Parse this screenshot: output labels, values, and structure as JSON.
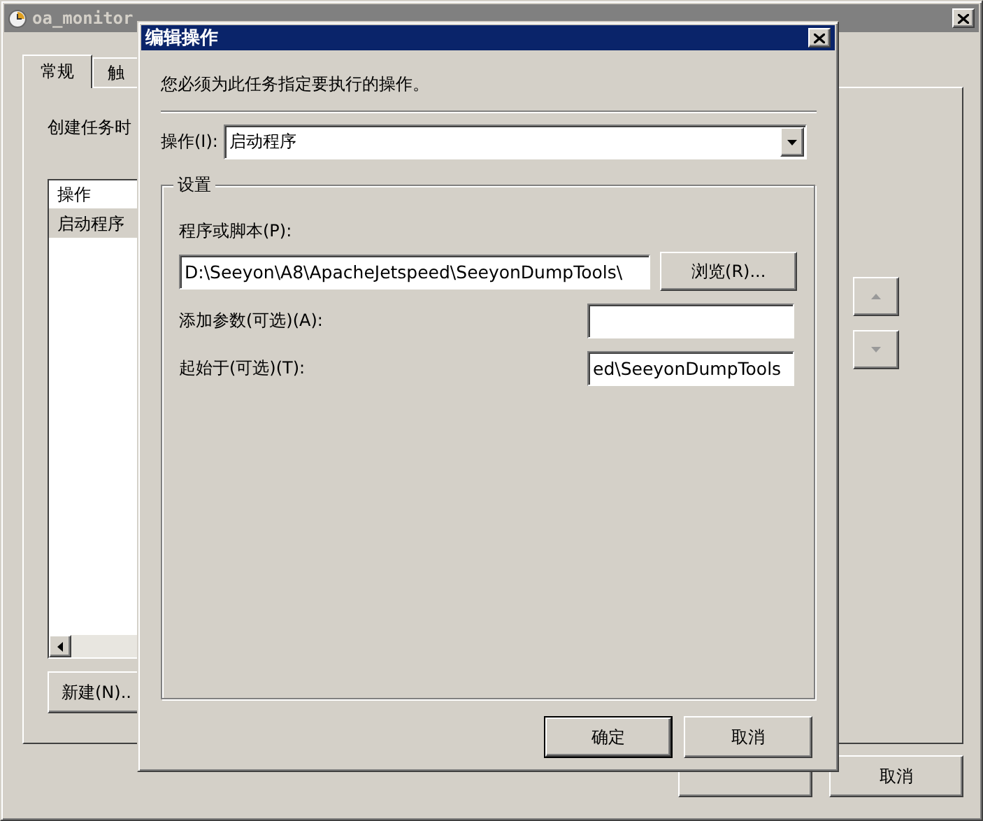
{
  "background_window": {
    "title": "oa_monitor",
    "tabs": [
      {
        "label": "常规",
        "selected": true
      },
      {
        "label": "触",
        "selected": false
      }
    ],
    "description": "创建任务时",
    "actions_list": {
      "columns": [
        "操作"
      ],
      "rows": [
        {
          "cells": [
            "启动程序"
          ],
          "selected": true
        }
      ]
    },
    "new_button": "新建(N)..",
    "footer_buttons": [
      {
        "kind": "covered"
      },
      {
        "kind": "text",
        "label": "取消"
      }
    ]
  },
  "dialog": {
    "title": "编辑操作",
    "instruction": "您必须为此任务指定要执行的操作。",
    "action": {
      "label": "操作(I):",
      "value": "启动程序"
    },
    "settings": {
      "title": "设置",
      "program": {
        "label": "程序或脚本(P):",
        "value": "D:\\Seeyon\\A8\\ApacheJetspeed\\SeeyonDumpTools\\",
        "browse_button": "浏览(R)..."
      },
      "arguments": {
        "label": "添加参数(可选)(A):"
      },
      "start_in": {
        "label": "起始于(可选)(T):",
        "value": "ed\\SeeyonDumpTools"
      }
    },
    "buttons": [
      {
        "label": "确定",
        "default": true
      },
      {
        "label": "取消",
        "default": false
      }
    ]
  }
}
